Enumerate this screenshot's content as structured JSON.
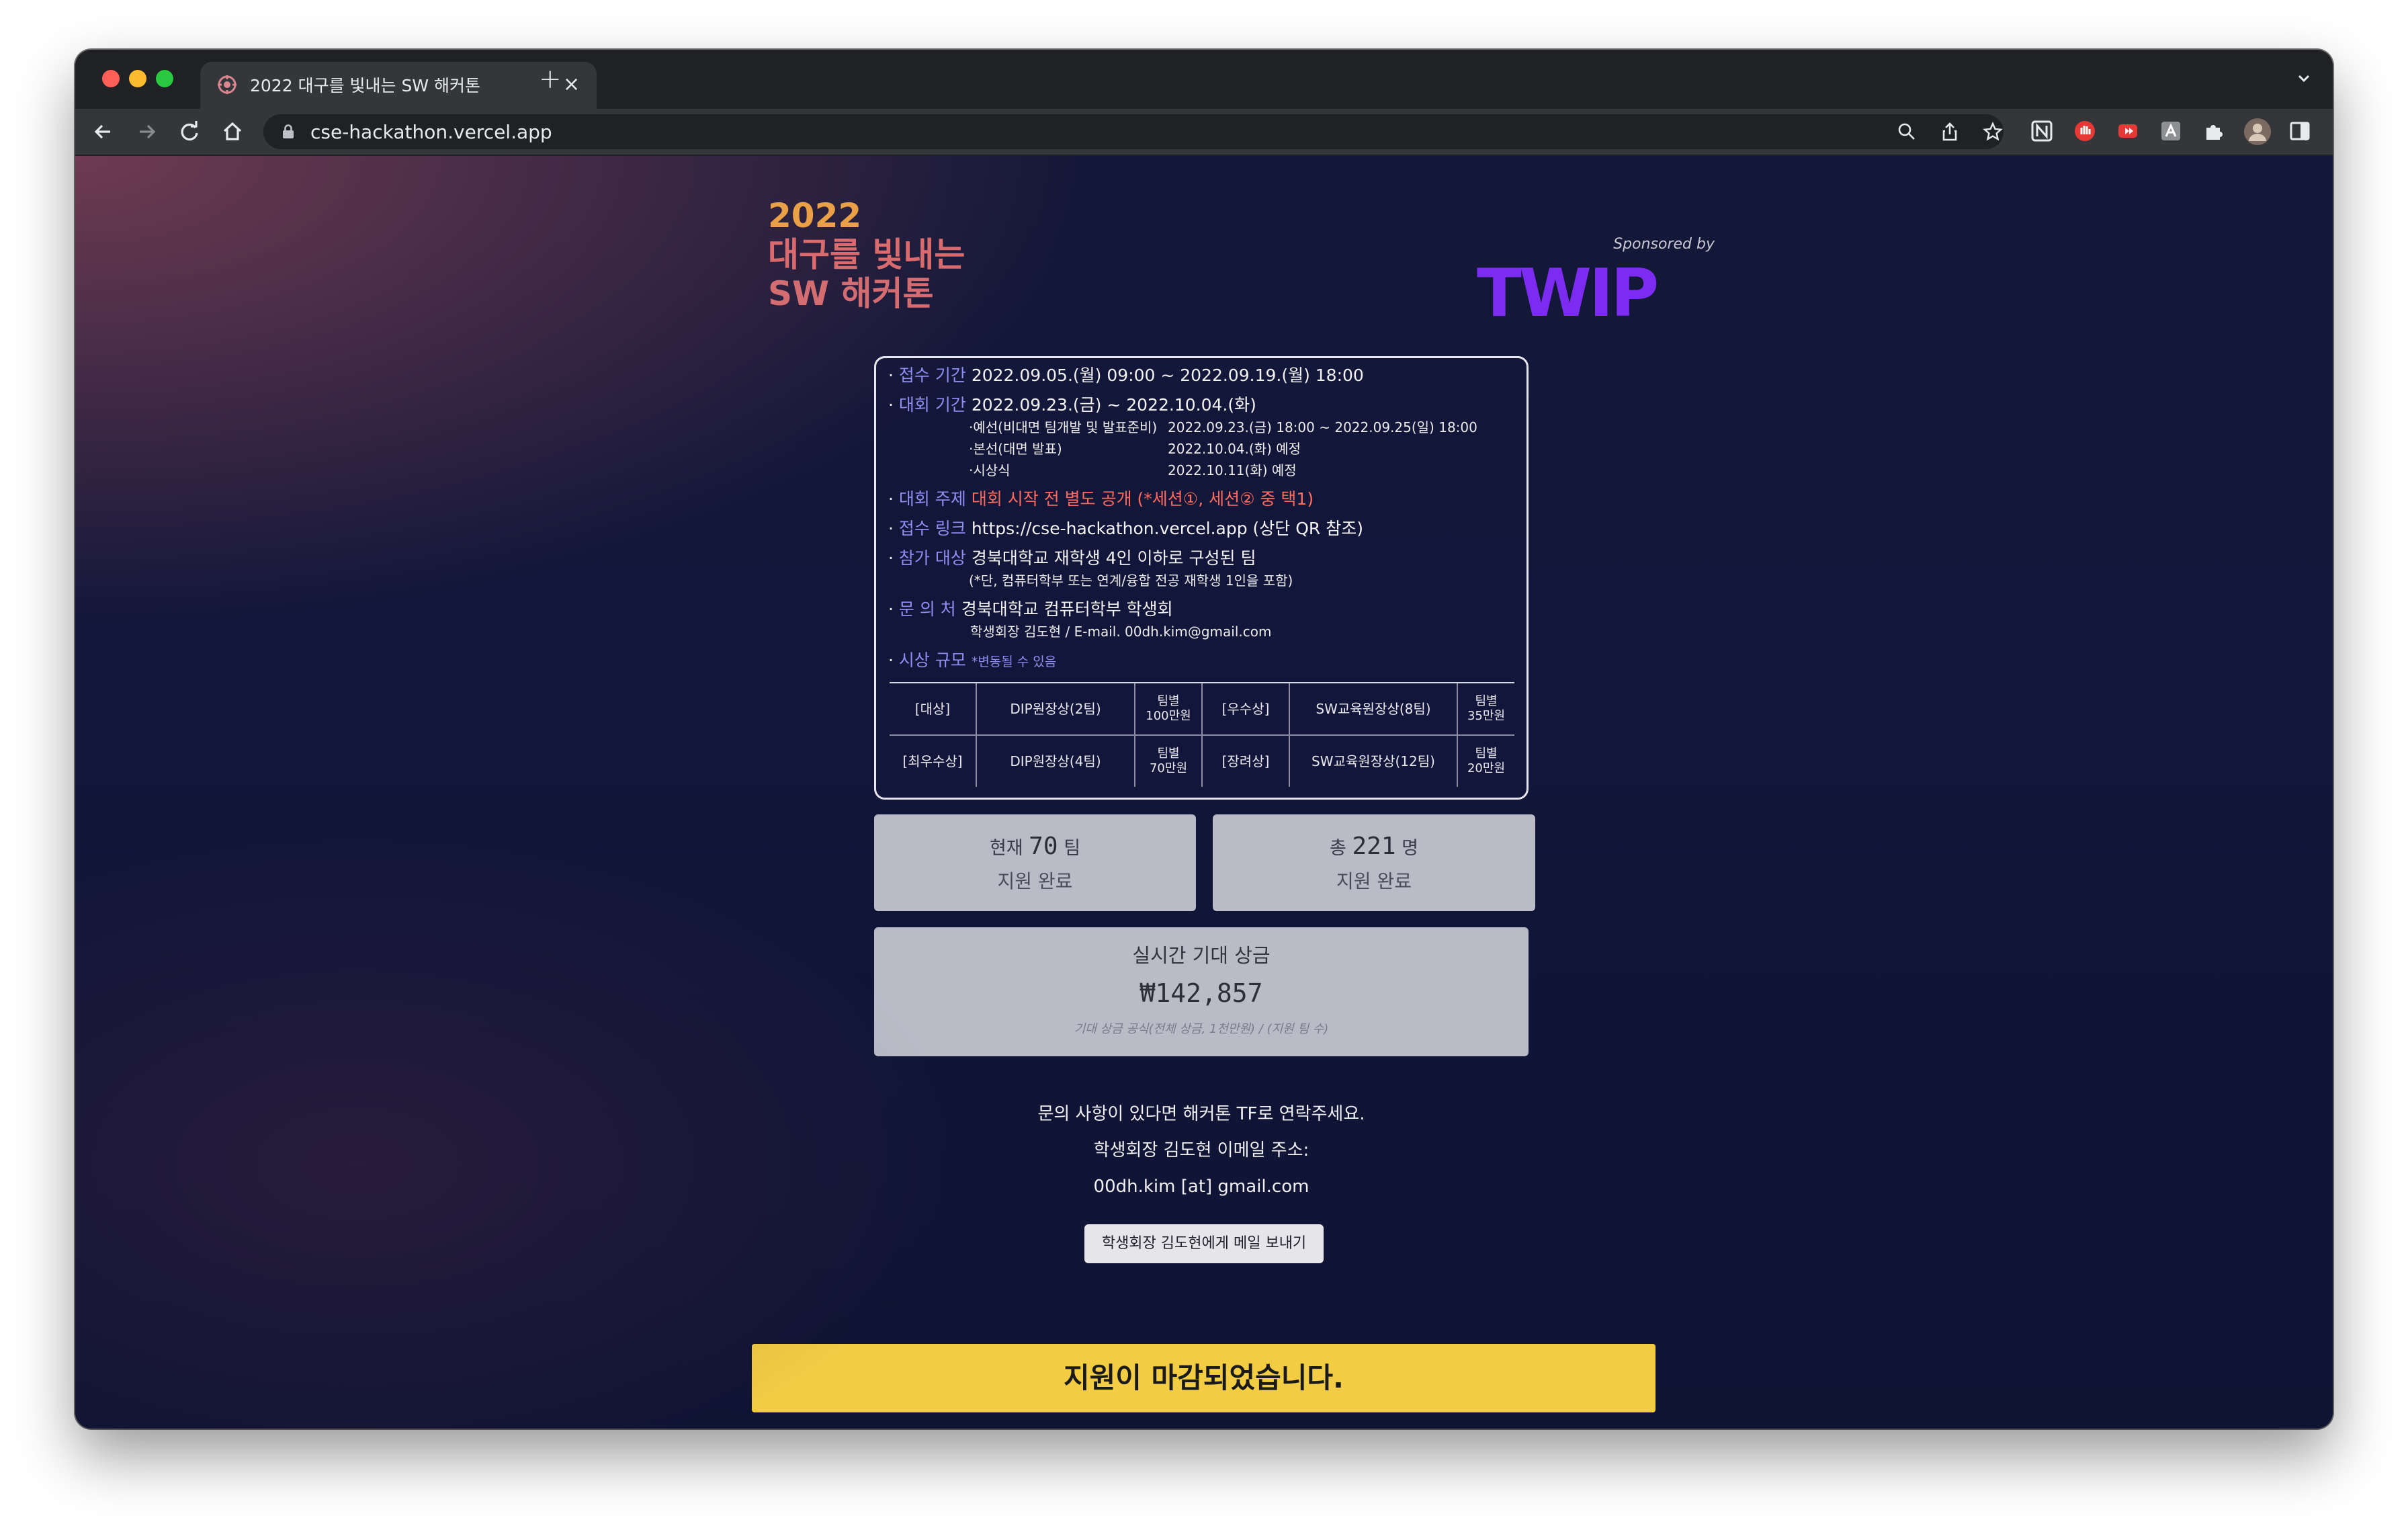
{
  "browser": {
    "tab": {
      "title": "2022 대구를 빛내는 SW 해커톤",
      "close": "×"
    },
    "new_tab": "+",
    "url": "cse-hackathon.vercel.app"
  },
  "colors": {
    "title_year": "#e9a046",
    "title_text": "#d96b6f",
    "label_blue": "#8e8ef0",
    "notice_red": "#ff6a5c",
    "card_bg": "#bbbbc8",
    "banner_yellow": "#f2cd43",
    "twip_purple": "#7b2cf0"
  },
  "header": {
    "title_year": "2022",
    "title_line2": "대구를 빛내는",
    "title_line3": "SW 해커톤",
    "sponsor_caption": "Sponsored by",
    "sponsor_logo_text": "TWIP"
  },
  "info": {
    "reception": {
      "bullet": "·",
      "label": "접수 기간",
      "value": "2022.09.05.(월) 09:00 ~ 2022.09.19.(월) 18:00"
    },
    "contest": {
      "bullet": "·",
      "label": "대회 기간",
      "value": "2022.09.23.(금) ~ 2022.10.04.(화)"
    },
    "schedule": [
      {
        "name": "·예선(비대면 팀개발 및 발표준비)",
        "date": "2022.09.23.(금) 18:00 ~ 2022.09.25(일) 18:00"
      },
      {
        "name": "·본선(대면 발표)",
        "date": "2022.10.04.(화) 예정"
      },
      {
        "name": "·시상식",
        "date": "2022.10.11(화) 예정"
      }
    ],
    "topic": {
      "bullet": "·",
      "label": "대회 주제",
      "value": "대회 시작 전 별도 공개 (*세션①, 세션② 중 택1)"
    },
    "link": {
      "bullet": "·",
      "label": "접수 링크",
      "value": "https://cse-hackathon.vercel.app (상단 QR 참조)"
    },
    "eligibility": {
      "bullet": "·",
      "label": "참가 대상",
      "value": "경북대학교 재학생 4인 이하로 구성된 팀",
      "note": "(*단, 컴퓨터학부 또는 연계/융합 전공 재학생 1인을 포함)"
    },
    "inquiry": {
      "bullet": "·",
      "label": "문  의  처",
      "value": "경북대학교 컴퓨터학부 학생회",
      "contact": "학생회장 김도현 / E-mail. 00dh.kim@gmail.com"
    },
    "awards": {
      "bullet": "·",
      "label": "시상 규모",
      "note": "*변동될 수 있음"
    }
  },
  "prize_table": [
    [
      "[대상]",
      "DIP원장상(2팀)",
      "팀별\n100만원",
      "[우수상]",
      "SW교육원장상(8팀)",
      "팀별\n35만원"
    ],
    [
      "[최우수상]",
      "DIP원장상(4팀)",
      "팀별\n70만원",
      "[장려상]",
      "SW교육원장상(12팀)",
      "팀별\n20만원"
    ]
  ],
  "stats": {
    "teams": {
      "prefix": "현재",
      "count": "70",
      "unit": "팀",
      "status": "지원 완료"
    },
    "people": {
      "prefix": "총",
      "count": "221",
      "unit": "명",
      "status": "지원 완료"
    }
  },
  "prize": {
    "title": "실시간 기대 상금",
    "amount": "₩142,857",
    "formula": "기대 상금 공식(전체 상금, 1천만원) / (지원 팀 수)"
  },
  "contact": {
    "line1": "문의 사항이 있다면 해커톤 TF로 연락주세요.",
    "line2": "학생회장 김도현 이메일 주소:",
    "line3": "00dh.kim [at] gmail.com",
    "button": "학생회장 김도현에게 메일 보내기"
  },
  "banner": "지원이 마감되었습니다."
}
